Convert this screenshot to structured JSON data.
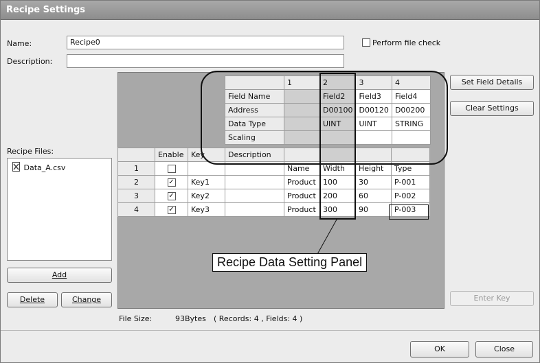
{
  "window": {
    "title": "Recipe Settings"
  },
  "form": {
    "name_label": "Name:",
    "name_value": "Recipe0",
    "description_label": "Description:",
    "description_value": "",
    "perform_file_check_label": "Perform file check"
  },
  "recipe_files": {
    "label": "Recipe Files:",
    "items": [
      "Data_A.csv"
    ],
    "add_label": "Add",
    "delete_label": "Delete",
    "change_label": "Change"
  },
  "field_header": {
    "columns": [
      "1",
      "2",
      "3",
      "4"
    ],
    "rows": [
      {
        "label": "Field Name",
        "values": [
          "",
          "Field2",
          "Field3",
          "Field4"
        ]
      },
      {
        "label": "Address",
        "values": [
          "",
          "D00100",
          "D00120",
          "D00200"
        ]
      },
      {
        "label": "Data Type",
        "values": [
          "",
          "UINT",
          "UINT",
          "STRING"
        ]
      },
      {
        "label": "Scaling",
        "values": [
          "",
          "",
          "",
          ""
        ]
      },
      {
        "label": "Description",
        "values": [
          "",
          "",
          "",
          ""
        ]
      }
    ]
  },
  "data_grid": {
    "headers": {
      "enable": "Enable",
      "key": "Key"
    },
    "rows": [
      {
        "num": "1",
        "enabled": false,
        "key": "",
        "cells": [
          "Name",
          "Width",
          "Height",
          "Type"
        ]
      },
      {
        "num": "2",
        "enabled": true,
        "key": "Key1",
        "cells": [
          "Product",
          "100",
          "30",
          "P-001"
        ]
      },
      {
        "num": "3",
        "enabled": true,
        "key": "Key2",
        "cells": [
          "Product",
          "200",
          "60",
          "P-002"
        ]
      },
      {
        "num": "4",
        "enabled": true,
        "key": "Key3",
        "cells": [
          "Product",
          "300",
          "90",
          "P-003"
        ]
      }
    ]
  },
  "annotation": {
    "panel_label": "Recipe Data Setting Panel"
  },
  "buttons": {
    "set_field_details": "Set Field Details",
    "clear_settings": "Clear Settings",
    "enter_key": "Enter Key",
    "ok": "OK",
    "close": "Close"
  },
  "footer": {
    "file_size_label": "File Size:",
    "file_size_value": "93Bytes",
    "records_fields": "( Records: 4 , Fields: 4 )"
  },
  "colors": {
    "titlebar": "#9a9a9a",
    "grid_background": "#a8a8a8",
    "shaded_cell": "#cfcfcf"
  }
}
